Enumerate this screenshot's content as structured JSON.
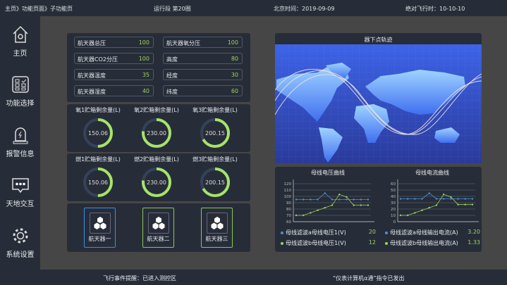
{
  "header": {
    "breadcrumb": "主页》功能页面》子功能页",
    "run_segment": "运行段 第20圈",
    "beijing_time": "北京时间：2019-09-09",
    "flight_time": "绝对飞行时：10-10-10"
  },
  "sidebar": {
    "items": [
      {
        "label": "主页",
        "icon": "home-icon"
      },
      {
        "label": "功能选择",
        "icon": "checklist-icon"
      },
      {
        "label": "报警信息",
        "icon": "alarm-icon"
      },
      {
        "label": "天地交互",
        "icon": "chat-icon"
      },
      {
        "label": "系统设置",
        "icon": "gear-icon"
      }
    ]
  },
  "params": [
    {
      "label": "航天器总压",
      "value": "100"
    },
    {
      "label": "航天器氧分压",
      "value": "100"
    },
    {
      "label": "航天器CO2分压",
      "value": "100"
    },
    {
      "label": "高度",
      "value": "80"
    },
    {
      "label": "航天器温度",
      "value": "35"
    },
    {
      "label": "经度",
      "value": "30"
    },
    {
      "label": "航天器湿度",
      "value": "40"
    },
    {
      "label": "纬度",
      "value": "60"
    }
  ],
  "oxygen_tanks": [
    {
      "label": "氧1贮箱剩余量(L)",
      "value": "150.06",
      "fraction": 0.5
    },
    {
      "label": "氧2贮箱剩余量(L)",
      "value": "230.00",
      "fraction": 0.77
    },
    {
      "label": "氧3贮箱剩余量(L)",
      "value": "200.15",
      "fraction": 0.67
    }
  ],
  "fuel_tanks": [
    {
      "label": "燃1贮箱剩余量(L)",
      "value": "150.06",
      "fraction": 0.5
    },
    {
      "label": "燃2贮箱剩余量(L)",
      "value": "230.00",
      "fraction": 0.77
    },
    {
      "label": "燃3贮箱剩余量(L)",
      "value": "200.15",
      "fraction": 0.67
    }
  ],
  "crafts": [
    {
      "label": "航天器一",
      "selected": true
    },
    {
      "label": "航天器二",
      "selected": false
    },
    {
      "label": "航天器三",
      "selected": false
    }
  ],
  "map": {
    "title": "器下点轨迹"
  },
  "colors": {
    "blue": "#4a90d9",
    "green": "#9fd160",
    "accent_select": "#3a8ee6"
  },
  "chart_data": [
    {
      "type": "line",
      "title": "母线电压曲线",
      "ylim": [
        60,
        120
      ],
      "yticks": [
        "60",
        "70",
        "80",
        "90",
        "100",
        "110",
        "120"
      ],
      "series": [
        {
          "name": "母线滤波a母线电压1(V)",
          "value": "20",
          "color": "#4a90d9",
          "values": [
            95,
            95,
            95,
            95,
            105,
            95,
            95,
            95,
            95,
            95,
            95
          ]
        },
        {
          "name": "母线滤波b母线电压1(V)",
          "value": "12",
          "color": "#9fd160",
          "values": [
            70,
            70,
            74,
            78,
            82,
            86,
            103,
            99,
            86,
            86,
            86
          ]
        }
      ]
    },
    {
      "type": "line",
      "title": "母线电流曲线",
      "ylim": [
        0,
        60
      ],
      "yticks": [
        "0",
        "10",
        "20",
        "30",
        "40",
        "50",
        "60"
      ],
      "series": [
        {
          "name": "母线滤波a母线输出电流(A)",
          "value": "3.20",
          "color": "#4a90d9",
          "values": [
            36,
            36,
            36,
            36,
            45,
            36,
            36,
            36,
            36,
            36,
            36
          ]
        },
        {
          "name": "母线滤波b母线输出电流(A)",
          "value": "1.33",
          "color": "#9fd160",
          "values": [
            10,
            10,
            14,
            18,
            22,
            26,
            43,
            39,
            27,
            27,
            27
          ]
        }
      ]
    }
  ],
  "footer": {
    "event": "飞行事件提醒：已进入测控区",
    "command": "“仪表计算机α通”指令已发出"
  }
}
